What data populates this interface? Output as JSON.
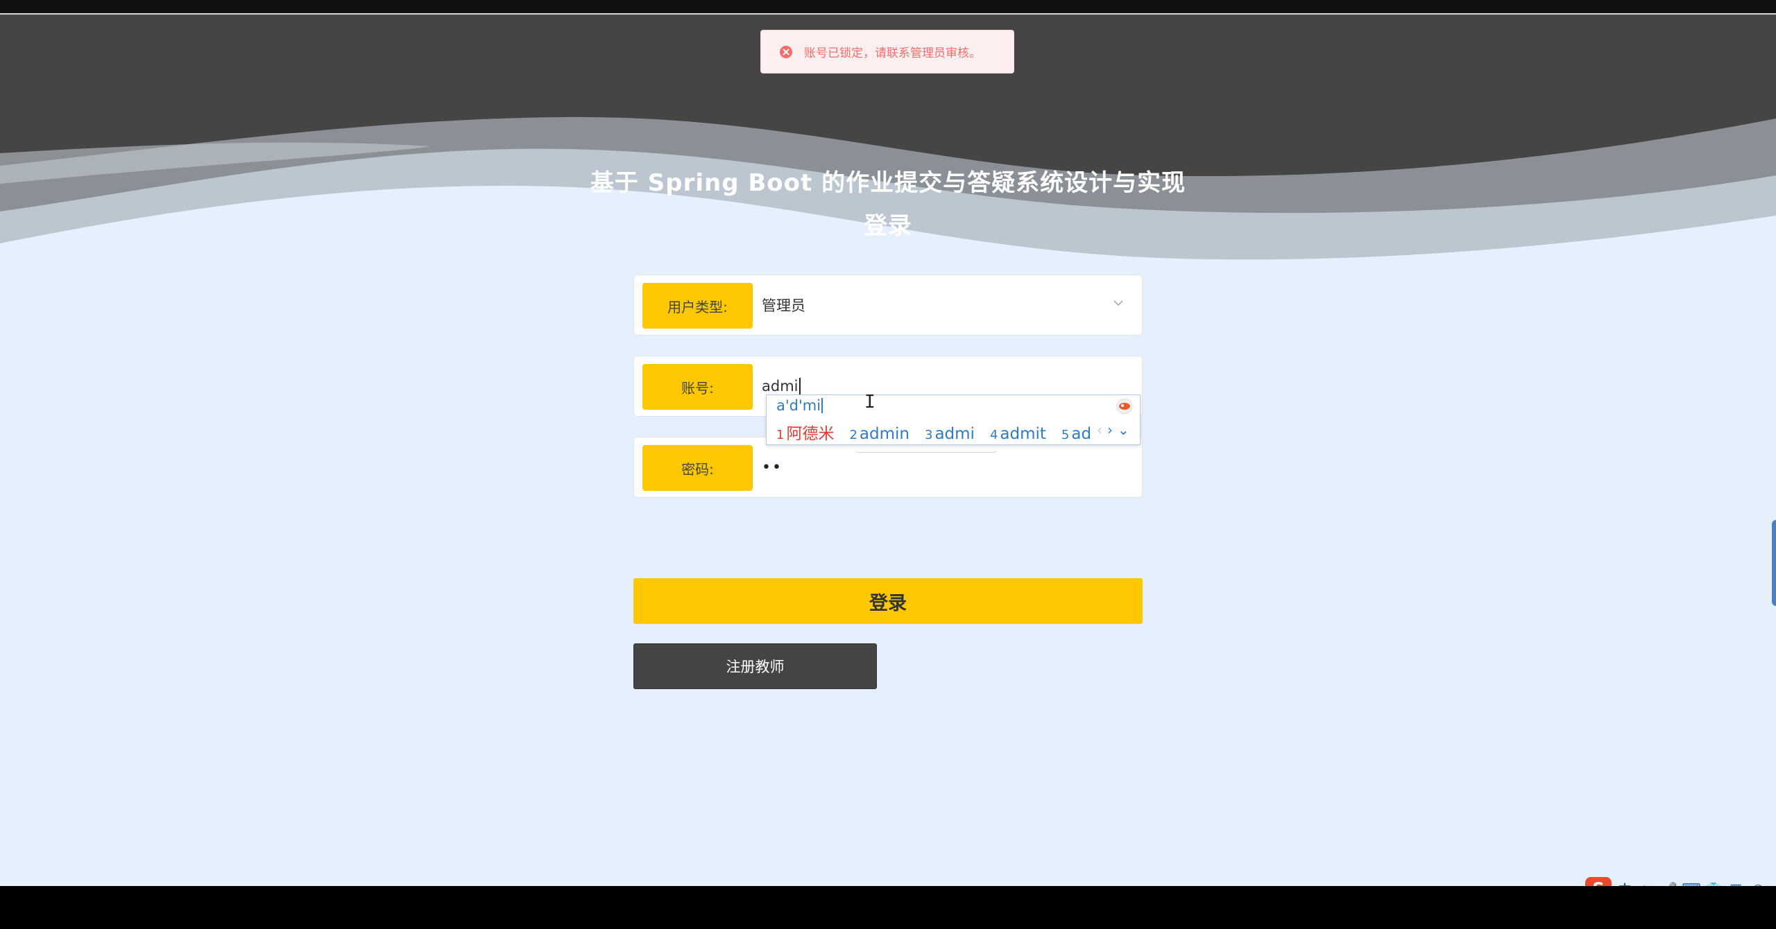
{
  "toast": {
    "message": "账号已锁定，请联系管理员审核。",
    "type": "error"
  },
  "page_title": "基于 Spring Boot 的作业提交与答疑系统设计与实现登录",
  "form": {
    "user_type": {
      "label": "用户类型:",
      "value": "管理员"
    },
    "account": {
      "label": "账号:",
      "value": "admi"
    },
    "password": {
      "label": "密码:",
      "value": "••"
    }
  },
  "ime": {
    "composition": "a'd'mi",
    "candidates": [
      {
        "num": "1",
        "text": "阿德米"
      },
      {
        "num": "2",
        "text": "admin"
      },
      {
        "num": "3",
        "text": "admi"
      },
      {
        "num": "4",
        "text": "admit"
      },
      {
        "num": "5",
        "text": "ad"
      }
    ],
    "nav": {
      "prev": "‹",
      "next": "›",
      "expand": "⌄"
    }
  },
  "buttons": {
    "login": "登录",
    "register_teacher": "注册教师"
  },
  "ime_toolbar": {
    "logo": "S",
    "items": [
      {
        "name": "chinese-mode",
        "text": "中"
      },
      {
        "name": "punctuation-mode",
        "text": "•,"
      },
      {
        "name": "voice",
        "text": "🎤"
      },
      {
        "name": "keyboard",
        "text": "⌨"
      },
      {
        "name": "skin",
        "text": "👕"
      },
      {
        "name": "toolbox",
        "text": "▦"
      },
      {
        "name": "mascot",
        "text": "◉"
      }
    ]
  },
  "colors": {
    "accent": "#fdc800",
    "background": "#e6effc",
    "header": "#454545",
    "error": "#f56c6c",
    "ime_text": "#2e7cc8"
  }
}
